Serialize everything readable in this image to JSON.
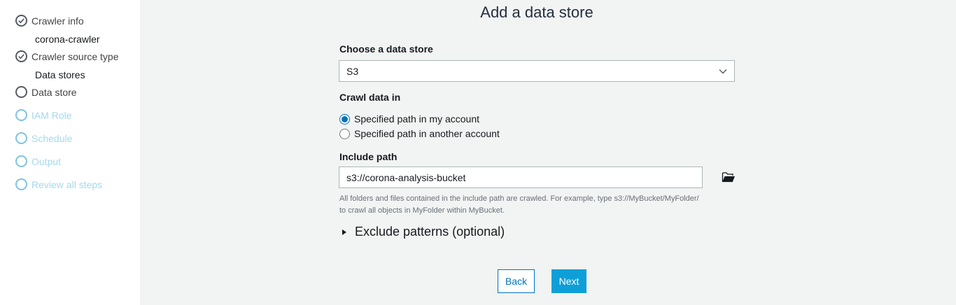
{
  "sidebar": {
    "steps": [
      {
        "label": "Crawler info",
        "state": "done",
        "sub": "corona-crawler"
      },
      {
        "label": "Crawler source type",
        "state": "done",
        "sub": "Data stores"
      },
      {
        "label": "Data store",
        "state": "current"
      },
      {
        "label": "IAM Role",
        "state": "disabled"
      },
      {
        "label": "Schedule",
        "state": "disabled"
      },
      {
        "label": "Output",
        "state": "disabled"
      },
      {
        "label": "Review all steps",
        "state": "disabled"
      }
    ]
  },
  "main": {
    "title": "Add a data store",
    "data_store": {
      "label": "Choose a data store",
      "value": "S3"
    },
    "crawl_data_in": {
      "label": "Crawl data in",
      "options": [
        "Specified path in my account",
        "Specified path in another account"
      ],
      "selected": "Specified path in my account"
    },
    "include_path": {
      "label": "Include path",
      "value": "s3://corona-analysis-bucket",
      "help_line1": "All folders and files contained in the include path are crawled. For example, type s3://MyBucket/MyFolder/",
      "help_line2": "to crawl all objects in MyFolder within MyBucket."
    },
    "exclude_patterns_label": "Exclude patterns (optional)",
    "back_label": "Back",
    "next_label": "Next"
  },
  "colors": {
    "accent": "#0073bb",
    "primary_button": "#0f9fd8",
    "disabled_step": "#a6d8ea"
  },
  "icons": {
    "done": "check-circle-icon",
    "current": "circle-icon",
    "folder": "folder-open-icon",
    "dropdown": "chevron-down-icon",
    "expander": "caret-right-icon"
  }
}
